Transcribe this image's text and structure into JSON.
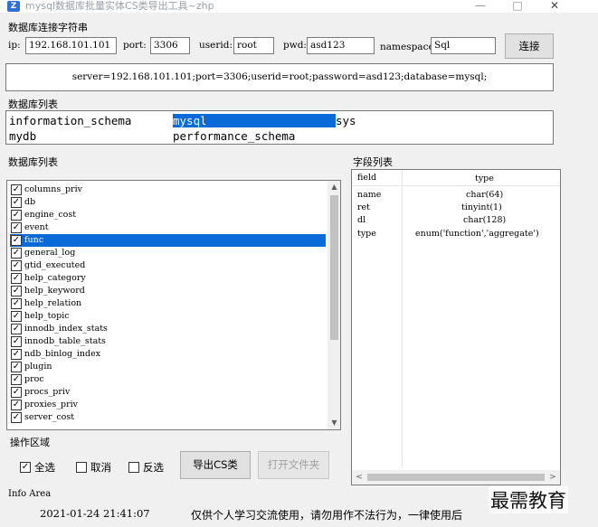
{
  "window": {
    "title": "mysql数据库批量实体CS类导出工具~zhp",
    "icon": "app-logo-icon"
  },
  "connection": {
    "group_label": "数据库连接字符串",
    "ip_label": "ip:",
    "ip_value": "192.168.101.101",
    "port_label": "port:",
    "port_value": "3306",
    "userid_label": "userid:",
    "userid_value": "root",
    "pwd_label": "pwd:",
    "pwd_value": "asd123",
    "namespace_label": "namespace:",
    "namespace_value": "Sql",
    "connect_button": "连接",
    "connection_string": "server=192.168.101.101;port=3306;userid=root;password=asd123;database=mysql;"
  },
  "databases": {
    "group_label": "数据库列表",
    "items": [
      "information_schema",
      "mysql",
      "sys",
      "mydb",
      "performance_schema"
    ],
    "selected": "mysql"
  },
  "tables": {
    "group_label": "数据库列表",
    "items": [
      {
        "name": "columns_priv",
        "checked": true,
        "selected": false
      },
      {
        "name": "db",
        "checked": true,
        "selected": false
      },
      {
        "name": "engine_cost",
        "checked": true,
        "selected": false
      },
      {
        "name": "event",
        "checked": true,
        "selected": false
      },
      {
        "name": "func",
        "checked": true,
        "selected": true
      },
      {
        "name": "general_log",
        "checked": true,
        "selected": false
      },
      {
        "name": "gtid_executed",
        "checked": true,
        "selected": false
      },
      {
        "name": "help_category",
        "checked": true,
        "selected": false
      },
      {
        "name": "help_keyword",
        "checked": true,
        "selected": false
      },
      {
        "name": "help_relation",
        "checked": true,
        "selected": false
      },
      {
        "name": "help_topic",
        "checked": true,
        "selected": false
      },
      {
        "name": "innodb_index_stats",
        "checked": true,
        "selected": false
      },
      {
        "name": "innodb_table_stats",
        "checked": true,
        "selected": false
      },
      {
        "name": "ndb_binlog_index",
        "checked": true,
        "selected": false
      },
      {
        "name": "plugin",
        "checked": true,
        "selected": false
      },
      {
        "name": "proc",
        "checked": true,
        "selected": false
      },
      {
        "name": "procs_priv",
        "checked": true,
        "selected": false
      },
      {
        "name": "proxies_priv",
        "checked": true,
        "selected": false
      },
      {
        "name": "server_cost",
        "checked": true,
        "selected": false
      }
    ]
  },
  "fields": {
    "group_label": "字段列表",
    "header": {
      "field": "field",
      "type": "type"
    },
    "rows": [
      {
        "field": "name",
        "type": "char(64)"
      },
      {
        "field": "ret",
        "type": "tinyint(1)"
      },
      {
        "field": "dl",
        "type": "char(128)"
      },
      {
        "field": "type",
        "type": "enum('function','aggregate')"
      }
    ]
  },
  "operations": {
    "group_label": "操作区域",
    "select_all": {
      "label": "全选",
      "checked": true
    },
    "deselect": {
      "label": "取消",
      "checked": false
    },
    "invert": {
      "label": "反选",
      "checked": false
    },
    "export_button": "导出CS类",
    "open_folder_button": "打开文件夹"
  },
  "info": {
    "group_label": "Info Area",
    "timestamp": "2021-01-24 21:41:07",
    "message": "仅供个人学习交流使用，请勿用作不法行为，一律使用后"
  },
  "watermark": "最需教育"
}
